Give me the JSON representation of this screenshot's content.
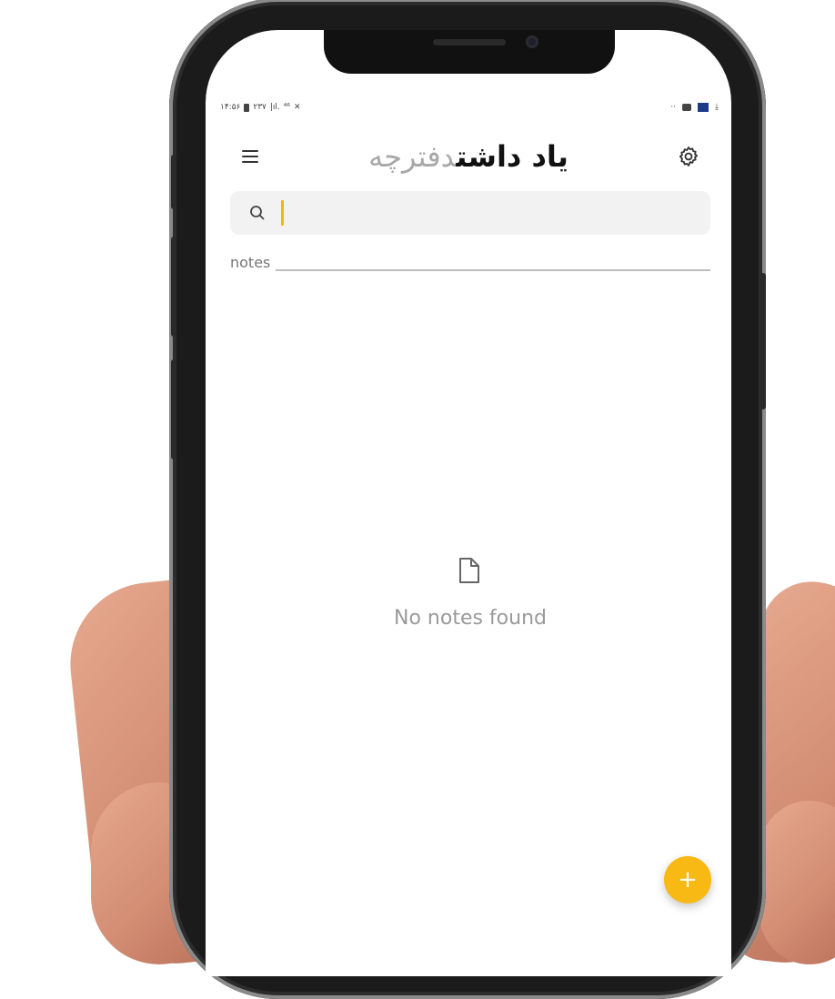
{
  "status_bar": {
    "time": "۱۴:۵۶",
    "network": "۲۳۷",
    "signal": "|ıl.",
    "wifi": "⁴⁶",
    "mute": "✕",
    "right_dots": "··",
    "download": "⤓"
  },
  "header": {
    "title_light": "دفترچه",
    "title_bold": "یاد داشت"
  },
  "search": {
    "value": "",
    "placeholder": ""
  },
  "notes_section": {
    "label": "notes"
  },
  "empty_state": {
    "icon": "file-icon",
    "text": "No notes found"
  },
  "fab": {
    "label": "+"
  },
  "colors": {
    "accent": "#f9b915",
    "caret": "#f5b800",
    "search_bg": "#f2f2f2",
    "title_light": "#a8a8a8",
    "title_bold": "#111111",
    "muted_text": "#9a9a9a"
  },
  "icons": [
    "menu-icon",
    "gear-icon",
    "search-icon",
    "file-icon"
  ]
}
